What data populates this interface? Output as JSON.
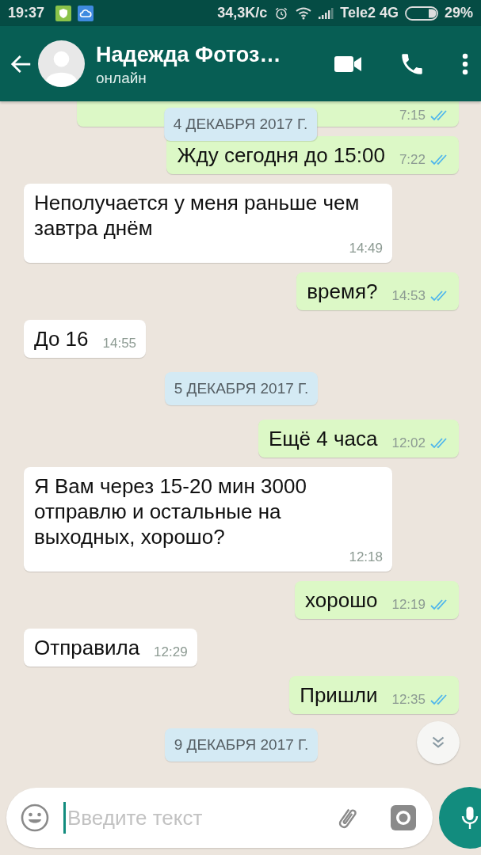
{
  "status_bar": {
    "time": "19:37",
    "speed": "34,3K/с",
    "carrier": "Tele2 4G",
    "battery": "29%"
  },
  "header": {
    "name": "Надежда Фотоз…",
    "status": "онлайн"
  },
  "sticky_date": "4 ДЕКАБРЯ 2017 Г.",
  "messages": [
    {
      "kind": "out",
      "time": "7:15",
      "read": true
    },
    {
      "kind": "out",
      "text": "Жду сегодня до 15:00",
      "time": "7:22",
      "read": true
    },
    {
      "kind": "in",
      "text": "Неполучается у меня раньше чем завтра днём",
      "time": "14:49"
    },
    {
      "kind": "out",
      "text": "время?",
      "time": "14:53",
      "read": true
    },
    {
      "kind": "in",
      "text": "До 16",
      "time": "14:55"
    },
    {
      "kind": "date",
      "text": "5 ДЕКАБРЯ 2017 Г."
    },
    {
      "kind": "out",
      "text": "Ещё 4 часа",
      "time": "12:02",
      "read": true
    },
    {
      "kind": "in",
      "text": "Я Вам через 15-20 мин 3000 отправлю и остальные на выходных, хорошо?",
      "time": "12:18"
    },
    {
      "kind": "out",
      "text": "хорошо",
      "time": "12:19",
      "read": true
    },
    {
      "kind": "in",
      "text": "Отправила",
      "time": "12:29"
    },
    {
      "kind": "out",
      "text": "Пришли",
      "time": "12:35",
      "read": true
    },
    {
      "kind": "date",
      "text": "9 ДЕКАБРЯ 2017 Г."
    }
  ],
  "input": {
    "placeholder": "Введите текст"
  }
}
